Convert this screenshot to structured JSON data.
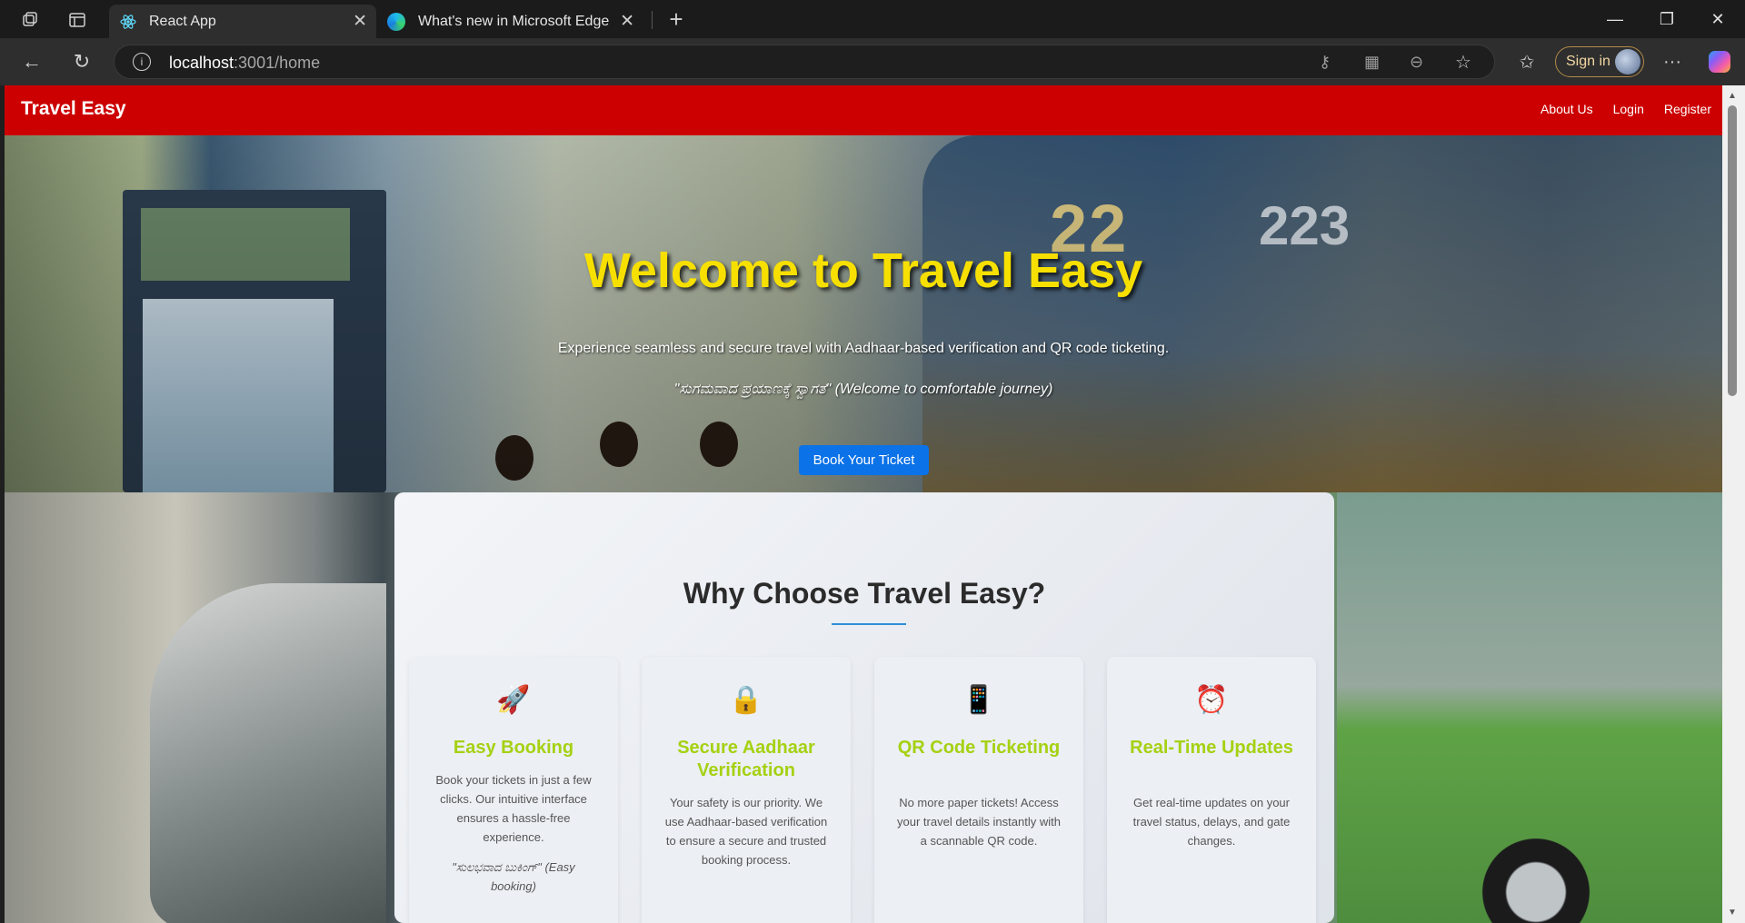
{
  "browser": {
    "tabs": [
      {
        "title": "React App",
        "icon": "react-icon"
      },
      {
        "title": "What's new in Microsoft Edge",
        "icon": "edge-icon"
      }
    ],
    "address": {
      "host": "localhost",
      "path": ":3001/home"
    },
    "signin_label": "Sign in"
  },
  "site": {
    "brand": "Travel Easy",
    "nav": [
      "About Us",
      "Login",
      "Register"
    ]
  },
  "hero": {
    "title": "Welcome to Travel Easy",
    "subtitle": "Experience seamless and secure travel with Aadhaar-based verification and QR code ticketing.",
    "kannada": "\"ಸುಗಮವಾದ ಪ್ರಯಾಣಕ್ಕೆ ಸ್ವಾಗತ\" (Welcome to comfortable journey)",
    "cta": "Book Your Ticket",
    "bus_numbers": [
      "22",
      "223"
    ]
  },
  "why": {
    "title": "Why Choose Travel Easy?",
    "cards": [
      {
        "icon": "🚀",
        "title": "Easy Booking",
        "desc": "Book your tickets in just a few clicks. Our intuitive interface ensures a hassle-free experience.",
        "kannada": "\"ಸುಲಭವಾದ ಬುಕಿಂಗ್\" (Easy booking)"
      },
      {
        "icon": "🔒",
        "title": "Secure Aadhaar Verification",
        "desc": "Your safety is our priority. We use Aadhaar-based verification to ensure a secure and trusted booking process."
      },
      {
        "icon": "📱",
        "title": "QR Code Ticketing",
        "desc": "No more paper tickets! Access your travel details instantly with a scannable QR code."
      },
      {
        "icon": "⏰",
        "title": "Real-Time Updates",
        "desc": "Get real-time updates on your travel status, delays, and gate changes."
      }
    ]
  }
}
